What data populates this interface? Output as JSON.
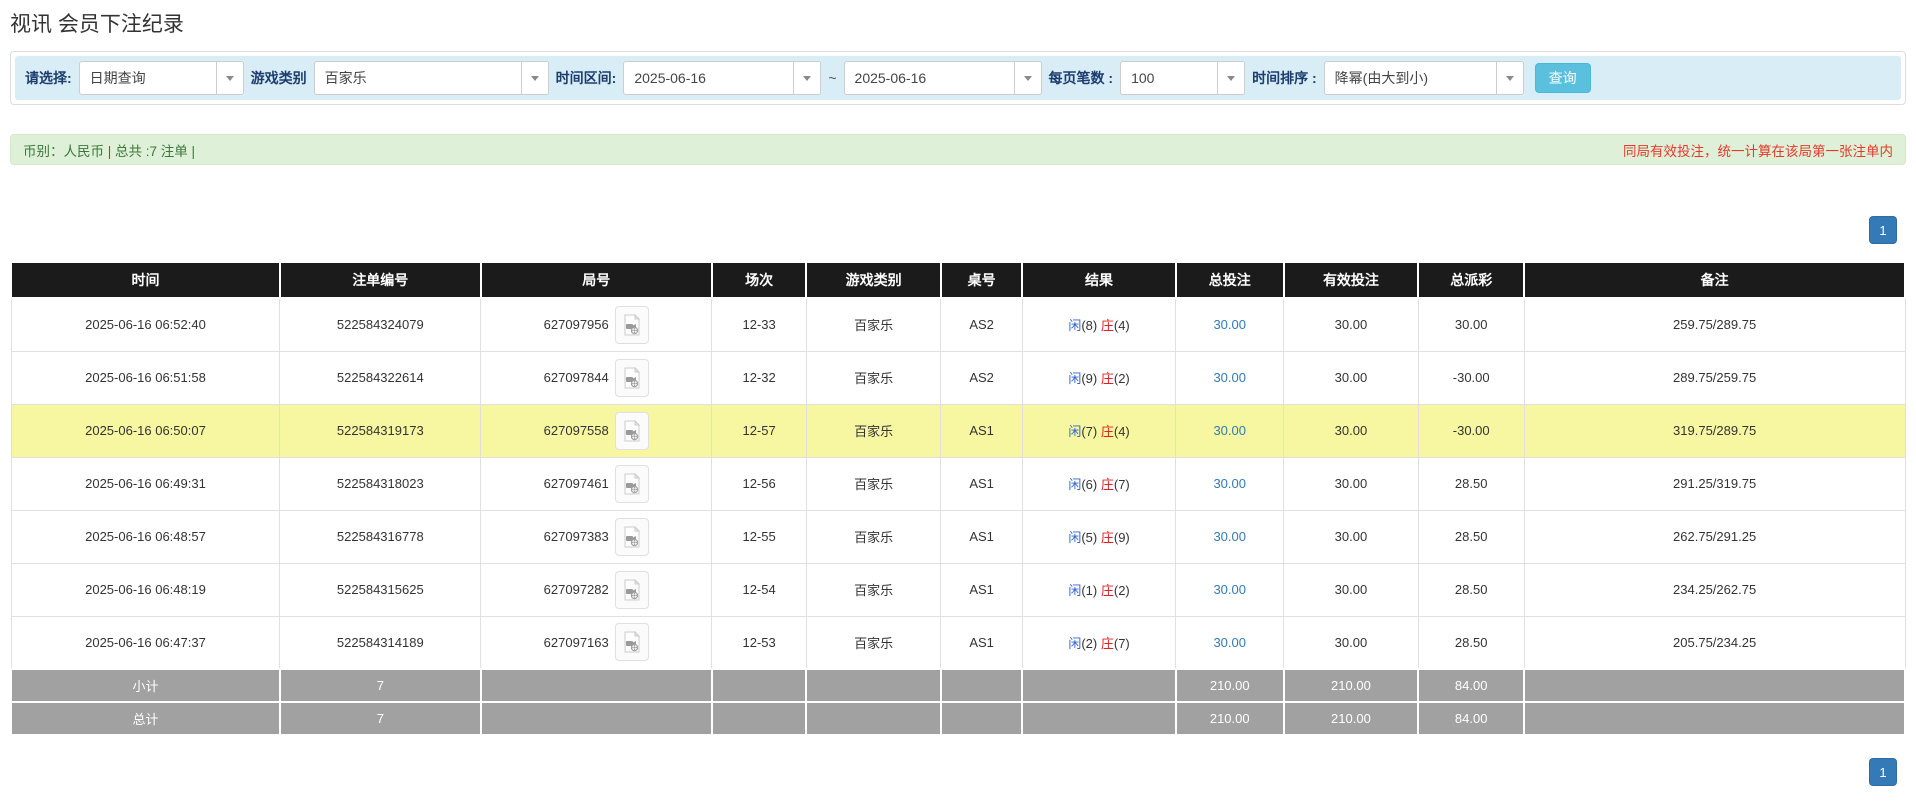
{
  "page": {
    "title": "视讯 会员下注纪录"
  },
  "filters": {
    "query_type": {
      "label": "请选择:",
      "value": "日期查询"
    },
    "game_type": {
      "label": "游戏类别",
      "value": "百家乐"
    },
    "date_range": {
      "label": "时间区间:",
      "from": "2025-06-16",
      "separator": "~",
      "to": "2025-06-16"
    },
    "page_size": {
      "label": "每页笔数 :",
      "value": "100"
    },
    "time_sort": {
      "label": "时间排序 :",
      "value": "降幂(由大到小)"
    },
    "search_button": "查询"
  },
  "summary_bar": {
    "left_text": "币别：人民币 | 总共 :7 注单 |",
    "right_note": "同局有效投注，统一计算在该局第一张注单内"
  },
  "pagination": {
    "page": "1"
  },
  "table": {
    "headers": [
      "时间",
      "注单编号",
      "局号",
      "场次",
      "游戏类别",
      "桌号",
      "结果",
      "总投注",
      "有效投注",
      "总派彩",
      "备注"
    ],
    "rows": [
      {
        "time": "2025-06-16 06:52:40",
        "bet_no": "522584324079",
        "round_no": "627097956",
        "session": "12-33",
        "game": "百家乐",
        "table_no": "AS2",
        "result": {
          "player_label": "闲",
          "player_score": "(8)",
          "banker_label": "庄",
          "banker_score": "(4)"
        },
        "total_bet": "30.00",
        "valid_bet": "30.00",
        "payout": "30.00",
        "note": "259.75/289.75"
      },
      {
        "time": "2025-06-16 06:51:58",
        "bet_no": "522584322614",
        "round_no": "627097844",
        "session": "12-32",
        "game": "百家乐",
        "table_no": "AS2",
        "result": {
          "player_label": "闲",
          "player_score": "(9)",
          "banker_label": "庄",
          "banker_score": "(2)"
        },
        "total_bet": "30.00",
        "valid_bet": "30.00",
        "payout": "-30.00",
        "note": "289.75/259.75"
      },
      {
        "time": "2025-06-16 06:50:07",
        "bet_no": "522584319173",
        "round_no": "627097558",
        "session": "12-57",
        "game": "百家乐",
        "table_no": "AS1",
        "result": {
          "player_label": "闲",
          "player_score": "(7)",
          "banker_label": "庄",
          "banker_score": "(4)"
        },
        "total_bet": "30.00",
        "valid_bet": "30.00",
        "payout": "-30.00",
        "note": "319.75/289.75"
      },
      {
        "time": "2025-06-16 06:49:31",
        "bet_no": "522584318023",
        "round_no": "627097461",
        "session": "12-56",
        "game": "百家乐",
        "table_no": "AS1",
        "result": {
          "player_label": "闲",
          "player_score": "(6)",
          "banker_label": "庄",
          "banker_score": "(7)"
        },
        "total_bet": "30.00",
        "valid_bet": "30.00",
        "payout": "28.50",
        "note": "291.25/319.75"
      },
      {
        "time": "2025-06-16 06:48:57",
        "bet_no": "522584316778",
        "round_no": "627097383",
        "session": "12-55",
        "game": "百家乐",
        "table_no": "AS1",
        "result": {
          "player_label": "闲",
          "player_score": "(5)",
          "banker_label": "庄",
          "banker_score": "(9)"
        },
        "total_bet": "30.00",
        "valid_bet": "30.00",
        "payout": "28.50",
        "note": "262.75/291.25"
      },
      {
        "time": "2025-06-16 06:48:19",
        "bet_no": "522584315625",
        "round_no": "627097282",
        "session": "12-54",
        "game": "百家乐",
        "table_no": "AS1",
        "result": {
          "player_label": "闲",
          "player_score": "(1)",
          "banker_label": "庄",
          "banker_score": "(2)"
        },
        "total_bet": "30.00",
        "valid_bet": "30.00",
        "payout": "28.50",
        "note": "234.25/262.75"
      },
      {
        "time": "2025-06-16 06:47:37",
        "bet_no": "522584314189",
        "round_no": "627097163",
        "session": "12-53",
        "game": "百家乐",
        "table_no": "AS1",
        "result": {
          "player_label": "闲",
          "player_score": "(2)",
          "banker_label": "庄",
          "banker_score": "(7)"
        },
        "total_bet": "30.00",
        "valid_bet": "30.00",
        "payout": "28.50",
        "note": "205.75/234.25"
      }
    ],
    "subtotal": {
      "label": "小计",
      "count": "7",
      "total_bet": "210.00",
      "valid_bet": "210.00",
      "payout": "84.00"
    },
    "total": {
      "label": "总计",
      "count": "7",
      "total_bet": "210.00",
      "valid_bet": "210.00",
      "payout": "84.00"
    }
  },
  "icons": {
    "dropdown_arrow": "chevron-down",
    "video_replay": "video-file"
  },
  "colors": {
    "header_bg": "#1b1b1b",
    "filter_bar_bg": "#d9edf7",
    "filter_label": "#1c3d6e",
    "summary_bg": "#dff0d8",
    "summary_text": "#3c763d",
    "note_red": "#e5392b",
    "link_blue": "#337ab7",
    "player_blue": "#3366cc",
    "banker_red": "#e02020",
    "highlight_yellow": "#f7f7a1",
    "footer_gray": "#a1a1a1",
    "search_button_bg": "#5bc0de",
    "pagination_bg": "#337ab7"
  }
}
